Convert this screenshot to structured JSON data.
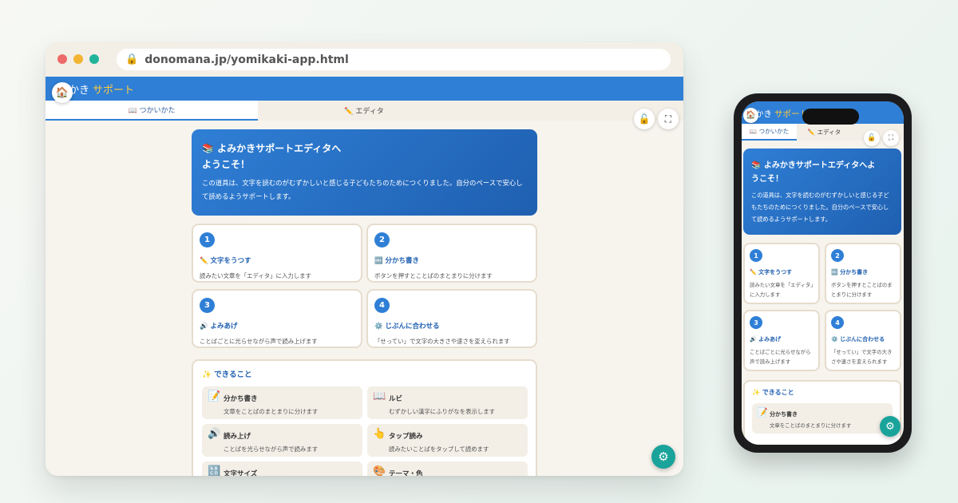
{
  "browser": {
    "url": "donomana.jp/yomikaki-app.html",
    "lock_icon": "🔒"
  },
  "app": {
    "brand_text": "かき",
    "brand_accent": "サポート",
    "home_icon": "🏠",
    "tabs": [
      {
        "label": "📖 つかいかた",
        "active": true
      },
      {
        "label": "✏️ エディタ",
        "active": false
      }
    ],
    "lock_icon": "🔓",
    "fullscreen_icon": "⛶",
    "settings_icon": "⚙"
  },
  "hero": {
    "title": "📚 よみかきサポートエディタへようこそ！",
    "body": "この道具は、文字を読むのがむずかしいと感じる子どもたちのためにつくりました。自分のペースで安心して読めるようサポートします。"
  },
  "steps": [
    {
      "num": "1",
      "title": "✏️ 文字をうつす",
      "desc": "読みたい文章を「エディタ」に入力します"
    },
    {
      "num": "2",
      "title": "🔤 分かち書き",
      "desc": "ボタンを押すとことばのまとまりに分けます"
    },
    {
      "num": "3",
      "title": "🔊 よみあげ",
      "desc": "ことばごとに光らせながら声で読み上げます"
    },
    {
      "num": "4",
      "title": "⚙️ じぶんに合わせる",
      "desc": "「せってい」で文字の大きさや速さを変えられます"
    }
  ],
  "features": {
    "title": "✨ できること",
    "items": [
      {
        "icon": "📝",
        "name": "分かち書き",
        "desc": "文章をことばのまとまりに分けます"
      },
      {
        "icon": "📖",
        "name": "ルビ",
        "desc": "むずかしい漢字にふりがなを表示します"
      },
      {
        "icon": "🔊",
        "name": "読み上げ",
        "desc": "ことばを光らせながら声で読みます"
      },
      {
        "icon": "👆",
        "name": "タップ読み",
        "desc": "読みたいことばをタップして読めます"
      },
      {
        "icon": "🔠",
        "name": "文字サイズ",
        "desc": ""
      },
      {
        "icon": "🎨",
        "name": "テーマ・色",
        "desc": ""
      }
    ]
  },
  "colors": {
    "primary": "#2f7fd6",
    "accent": "#ffc93c",
    "teal": "#1aa39a",
    "cream": "#f3efe7"
  }
}
